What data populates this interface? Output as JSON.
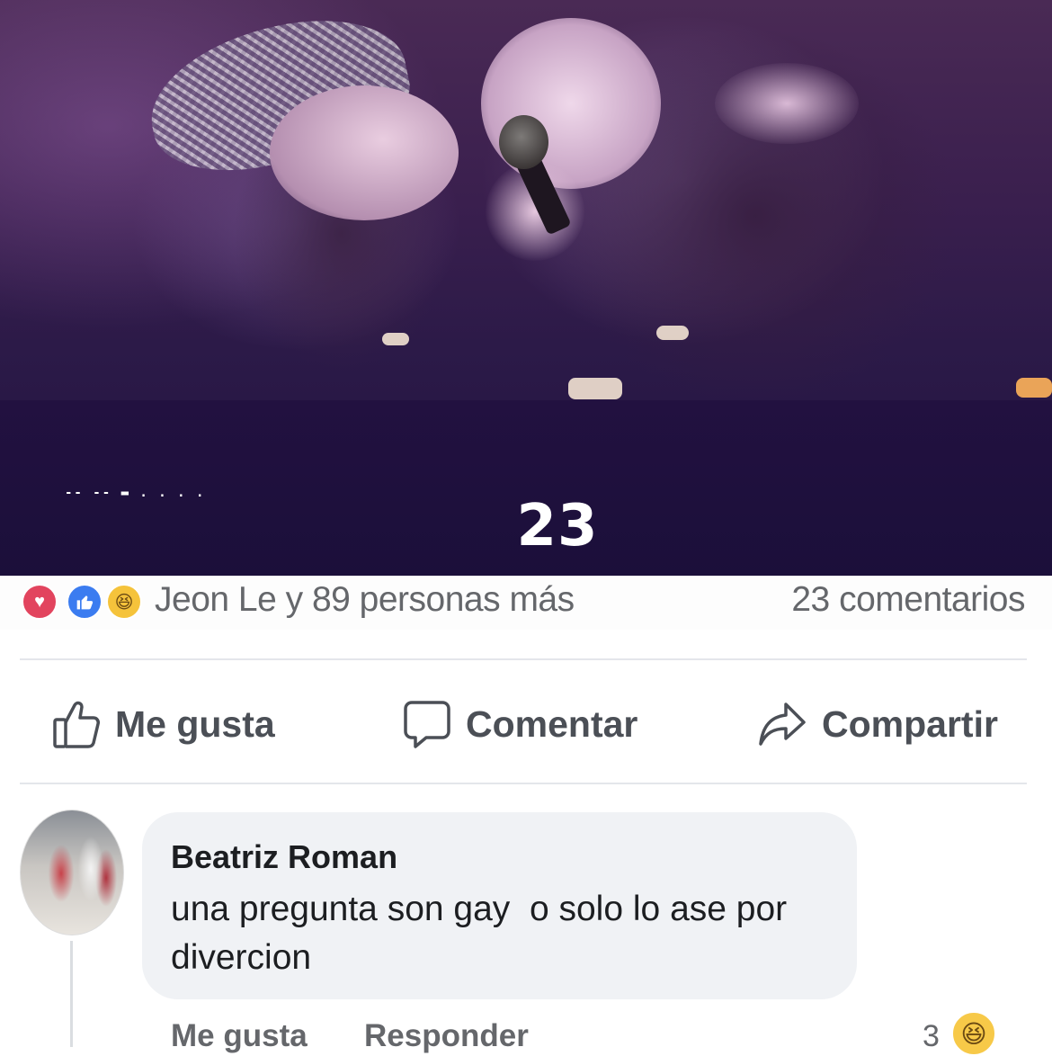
{
  "photo": {
    "caption_dashes": "-- -- ▬ . . . .",
    "big_number": "23"
  },
  "reactions": {
    "icons": [
      "love-icon",
      "like-icon",
      "haha-icon"
    ],
    "summary": "Jeon Le y 89 personas más",
    "comments_count": "23 comentarios"
  },
  "actions": {
    "like": "Me gusta",
    "comment": "Comentar",
    "share": "Compartir"
  },
  "comment": {
    "author": "Beatriz Roman",
    "text": "una pregunta son gay  o solo lo ase por\ndivercion",
    "like_label": "Me gusta",
    "reply_label": "Responder",
    "reaction_count": "3",
    "reaction_icon": "haha-icon"
  },
  "colors": {
    "love": "#e2445e",
    "like": "#3b7cf0",
    "haha": "#f5c33b",
    "secondary_text": "#65676b",
    "bubble": "#f0f2f5"
  }
}
